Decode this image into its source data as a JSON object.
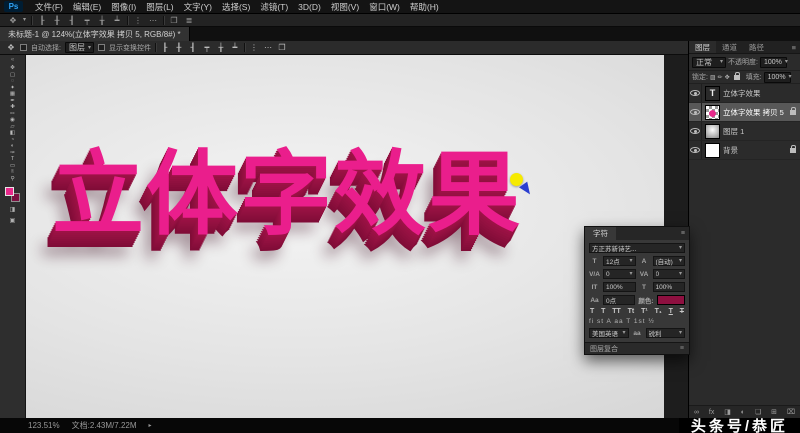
{
  "app": {
    "logo": "Ps"
  },
  "icons": {
    "chevron_down": "▾",
    "menu": "≡",
    "collapse_left": "«",
    "popup_arrow": "▸"
  },
  "menu_bar": {
    "items": [
      "文件(F)",
      "编辑(E)",
      "图像(I)",
      "图层(L)",
      "文字(Y)",
      "选择(S)",
      "滤镜(T)",
      "3D(D)",
      "视图(V)",
      "窗口(W)",
      "帮助(H)"
    ]
  },
  "options_bar": {
    "icons": [
      {
        "name": "tool-preset-icon",
        "glyph": "✥"
      },
      {
        "name": "align-left-icon",
        "glyph": "┠"
      },
      {
        "name": "align-center-horizontal-icon",
        "glyph": "╂"
      },
      {
        "name": "align-right-icon",
        "glyph": "┨"
      },
      {
        "name": "align-top-icon",
        "glyph": "┯"
      },
      {
        "name": "align-middle-vertical-icon",
        "glyph": "╁"
      },
      {
        "name": "align-bottom-icon",
        "glyph": "┷"
      },
      {
        "name": "distribute-vertical-icon",
        "glyph": "⋮"
      },
      {
        "name": "distribute-horizontal-icon",
        "glyph": "⋯"
      },
      {
        "name": "auto-align-icon",
        "glyph": "❐"
      },
      {
        "name": "workspace-switcher-icon",
        "glyph": "≣"
      }
    ]
  },
  "document_tab": {
    "title": "未标题-1 @ 124%(立体字效果 拷贝 5, RGB/8#) *"
  },
  "move_options": {
    "tool_icon": "✥",
    "auto_select_label": "自动选择:",
    "auto_select_value": "图层",
    "show_transform_label": "显示变换控件",
    "align_icons": [
      "┠",
      "╂",
      "┨",
      "┯",
      "╁",
      "┷"
    ],
    "extra_icons": [
      "⋮",
      "⋯",
      "❐"
    ]
  },
  "toolbar": {
    "foreground_color": "#e82a8c",
    "background_color": "#7a1040",
    "tools": [
      {
        "name": "move-tool-icon",
        "glyph": "✥"
      },
      {
        "name": "marquee-tool-icon",
        "glyph": "▢"
      },
      {
        "name": "lasso-tool-icon",
        "glyph": "◌"
      },
      {
        "name": "quick-selection-tool-icon",
        "glyph": "✦"
      },
      {
        "name": "crop-tool-icon",
        "glyph": "▦"
      },
      {
        "name": "eyedropper-tool-icon",
        "glyph": "✒"
      },
      {
        "name": "healing-brush-tool-icon",
        "glyph": "✚"
      },
      {
        "name": "brush-tool-icon",
        "glyph": "✏"
      },
      {
        "name": "clone-stamp-tool-icon",
        "glyph": "◉"
      },
      {
        "name": "eraser-tool-icon",
        "glyph": "▱"
      },
      {
        "name": "gradient-tool-icon",
        "glyph": "◧"
      },
      {
        "name": "blur-tool-icon",
        "glyph": "◔"
      },
      {
        "name": "dodge-tool-icon",
        "glyph": "◐"
      },
      {
        "name": "pen-tool-icon",
        "glyph": "✑"
      },
      {
        "name": "type-tool-icon",
        "glyph": "T"
      },
      {
        "name": "shape-tool-icon",
        "glyph": "▭"
      },
      {
        "name": "hand-tool-icon",
        "glyph": "✌"
      },
      {
        "name": "zoom-tool-icon",
        "glyph": "⚲"
      }
    ],
    "extra": [
      {
        "name": "quick-mask-icon",
        "glyph": "◨"
      },
      {
        "name": "screen-mode-icon",
        "glyph": "▣"
      }
    ]
  },
  "canvas": {
    "headline": "立体字效果",
    "text_color": "#ea1e8c",
    "extrude_color": "#8e1040",
    "marker_color": "#f6ea00"
  },
  "layers_panel": {
    "tabs": [
      "图层",
      "通道",
      "路径"
    ],
    "blend_mode": "正常",
    "opacity_label": "不透明度:",
    "opacity_value": "100%",
    "lock_label": "锁定:",
    "lock_icons": [
      "▨",
      "✏",
      "✥"
    ],
    "fill_label": "填充:",
    "fill_value": "100%",
    "layers": [
      {
        "name": "立体字效果",
        "thumb_glyph": "T"
      },
      {
        "name": "立体字效果 拷贝 5"
      },
      {
        "name": "图层 1"
      },
      {
        "name": "背景"
      }
    ],
    "bottom_icons": [
      {
        "name": "link-layers-icon",
        "glyph": "∞"
      },
      {
        "name": "layer-effects-icon",
        "glyph": "fx"
      },
      {
        "name": "layer-mask-icon",
        "glyph": "◨"
      },
      {
        "name": "adjustment-layer-icon",
        "glyph": "◐"
      },
      {
        "name": "layer-group-icon",
        "glyph": "❏"
      },
      {
        "name": "new-layer-icon",
        "glyph": "⊞"
      },
      {
        "name": "delete-layer-icon",
        "glyph": "⌧"
      }
    ]
  },
  "character_panel": {
    "title": "字符",
    "font_family": "方正苏新诗艺...",
    "size_label": "T",
    "size_value": "12点",
    "leading_label": "A",
    "leading_value": "(自动)",
    "kerning_label": "V/A",
    "kerning_value": "0",
    "tracking_label": "VA",
    "tracking_value": "0",
    "vscale_label": "IT",
    "vscale_value": "100%",
    "hscale_label": "T",
    "hscale_value": "100%",
    "baseline_label": "Aa",
    "baseline_value": "0点",
    "color_label": "颜色:",
    "color": "#8e1040",
    "style_buttons": [
      "T",
      "T",
      "TT",
      "Tt",
      "T¹",
      "T₁",
      "T",
      "T"
    ],
    "opentype_buttons": "fi  st  A  aa  T  1st  ½",
    "language_value": "美国英语",
    "antialias_label": "aa",
    "antialias_value": "锐利",
    "docked_tab": "图层复合"
  },
  "status_bar": {
    "zoom": "123.51%",
    "doc_info": "文档:2.43M/7.22M"
  },
  "watermark": "头条号/恭匠"
}
